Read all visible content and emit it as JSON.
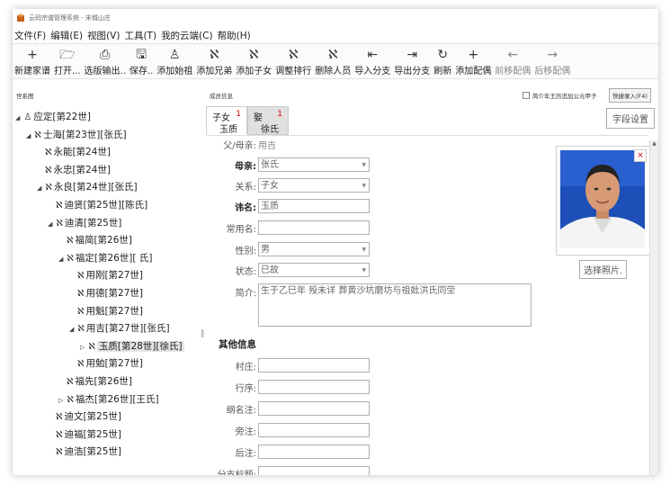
{
  "title": "云码宗谱管理系统 - 宋城山庄",
  "menu": [
    "文件(F)",
    "编辑(E)",
    "视图(V)",
    "工具(T)",
    "我的云端(C)",
    "帮助(H)"
  ],
  "toolbar": [
    {
      "icon": "plus-icon",
      "glyph": "+",
      "label": "新建家谱"
    },
    {
      "icon": "folder-open-icon",
      "glyph": "🗁",
      "label": "打开..."
    },
    {
      "icon": "printer-icon",
      "glyph": "⎙",
      "label": "选版输出.."
    },
    {
      "icon": "save-icon",
      "glyph": "🖫",
      "label": "保存.."
    },
    {
      "icon": "ancestor-icon",
      "glyph": "♙",
      "label": "添加始祖"
    },
    {
      "icon": "person-icon",
      "glyph": "ℵ",
      "label": "添加兄弟"
    },
    {
      "icon": "person-icon",
      "glyph": "ℵ",
      "label": "添加子女"
    },
    {
      "icon": "person-sort-icon",
      "glyph": "ℵ",
      "label": "调整排行"
    },
    {
      "icon": "person-remove-icon",
      "glyph": "ℵ",
      "label": "删除人员"
    },
    {
      "icon": "import-branch-icon",
      "glyph": "⇤",
      "label": "导入分支"
    },
    {
      "icon": "export-branch-icon",
      "glyph": "⇥",
      "label": "导出分支"
    },
    {
      "icon": "refresh-icon",
      "glyph": "↻",
      "label": "刷新"
    },
    {
      "icon": "plus-icon",
      "glyph": "+",
      "label": "添加配偶"
    },
    {
      "icon": "arrow-left-icon",
      "glyph": "←",
      "label": "前移配偶",
      "dim": true
    },
    {
      "icon": "arrow-right-icon",
      "glyph": "→",
      "label": "后移配偶",
      "dim": true
    }
  ],
  "panels": {
    "tree_label": "世系图",
    "detail_label": "成员信息",
    "checkbox_label": "简介年王历追加公元甲子",
    "quick_entry": "快捷录入(F4)"
  },
  "tree": [
    {
      "text": "应定[第22世]",
      "depth": 0,
      "arrow": "◢",
      "icon": "♙"
    },
    {
      "text": "士海[第23世][张氏]",
      "depth": 1,
      "arrow": "◢",
      "icon": "ℵ"
    },
    {
      "text": "永能[第24世]",
      "depth": 2,
      "arrow": "",
      "icon": "ℵ"
    },
    {
      "text": "永忠[第24世]",
      "depth": 2,
      "arrow": "",
      "icon": "ℵ"
    },
    {
      "text": "永良[第24世][张氏]",
      "depth": 2,
      "arrow": "◢",
      "icon": "ℵ"
    },
    {
      "text": "迪贤[第25世][陈氏]",
      "depth": 3,
      "arrow": "",
      "icon": "ℵ"
    },
    {
      "text": "迪清[第25世]",
      "depth": 3,
      "arrow": "◢",
      "icon": "ℵ"
    },
    {
      "text": "福简[第26世]",
      "depth": 4,
      "arrow": "",
      "icon": "ℵ"
    },
    {
      "text": "福定[第26世][ 氏]",
      "depth": 4,
      "arrow": "◢",
      "icon": "ℵ"
    },
    {
      "text": "用刚[第27世]",
      "depth": 5,
      "arrow": "",
      "icon": "ℵ"
    },
    {
      "text": "用德[第27世]",
      "depth": 5,
      "arrow": "",
      "icon": "ℵ"
    },
    {
      "text": "用魁[第27世]",
      "depth": 5,
      "arrow": "",
      "icon": "ℵ"
    },
    {
      "text": "用吉[第27世][张氏]",
      "depth": 5,
      "arrow": "◢",
      "icon": "ℵ"
    },
    {
      "text": "玉质[第28世][徐氏]",
      "depth": 6,
      "arrow": "▷",
      "icon": "ℵ",
      "selected": true
    },
    {
      "text": "用勉[第27世]",
      "depth": 5,
      "arrow": "",
      "icon": "ℵ"
    },
    {
      "text": "福先[第26世]",
      "depth": 4,
      "arrow": "",
      "icon": "ℵ"
    },
    {
      "text": "福杰[第26世][王氏]",
      "depth": 4,
      "arrow": "▷",
      "icon": "ℵ"
    },
    {
      "text": "迪文[第25世]",
      "depth": 3,
      "arrow": "",
      "icon": "ℵ"
    },
    {
      "text": "迪福[第25世]",
      "depth": 3,
      "arrow": "",
      "icon": "ℵ"
    },
    {
      "text": "迪浩[第25世]",
      "depth": 3,
      "arrow": "",
      "icon": "ℵ"
    }
  ],
  "tabs": [
    {
      "top": "子女",
      "bottom": "玉质",
      "badge": "1",
      "active": true
    },
    {
      "top": "娶",
      "bottom": "徐氏",
      "badge": "1",
      "active": false
    }
  ],
  "field_settings": "字段设置",
  "form": {
    "parent_label": "父/母亲:",
    "parent_value": "用吉",
    "mother_label": "母亲:",
    "mother_value": "张氏",
    "relation_label": "关系:",
    "relation_value": "子女",
    "name_label": "讳名:",
    "name_value": "玉质",
    "common_name_label": "常用名:",
    "common_name_value": "",
    "gender_label": "性别:",
    "gender_value": "男",
    "status_label": "状态:",
    "status_value": "已故",
    "bio_label": "简介:",
    "bio_value": "生于乙巳年  殁未详  葬黄沙坑磨坊与祖妣洪氏同茔",
    "other_title": "其他信息",
    "village_label": "村庄:",
    "village_value": "",
    "order_label": "行序:",
    "order_value": "",
    "note_label": "纲名注:",
    "note_value": "",
    "side_label": "旁注:",
    "side_value": "",
    "back_label": "后注:",
    "back_value": "",
    "branch_label": "分支标题:",
    "branch_value": ""
  },
  "photo": {
    "choose_label": "选择照片.",
    "close_glyph": "×"
  }
}
